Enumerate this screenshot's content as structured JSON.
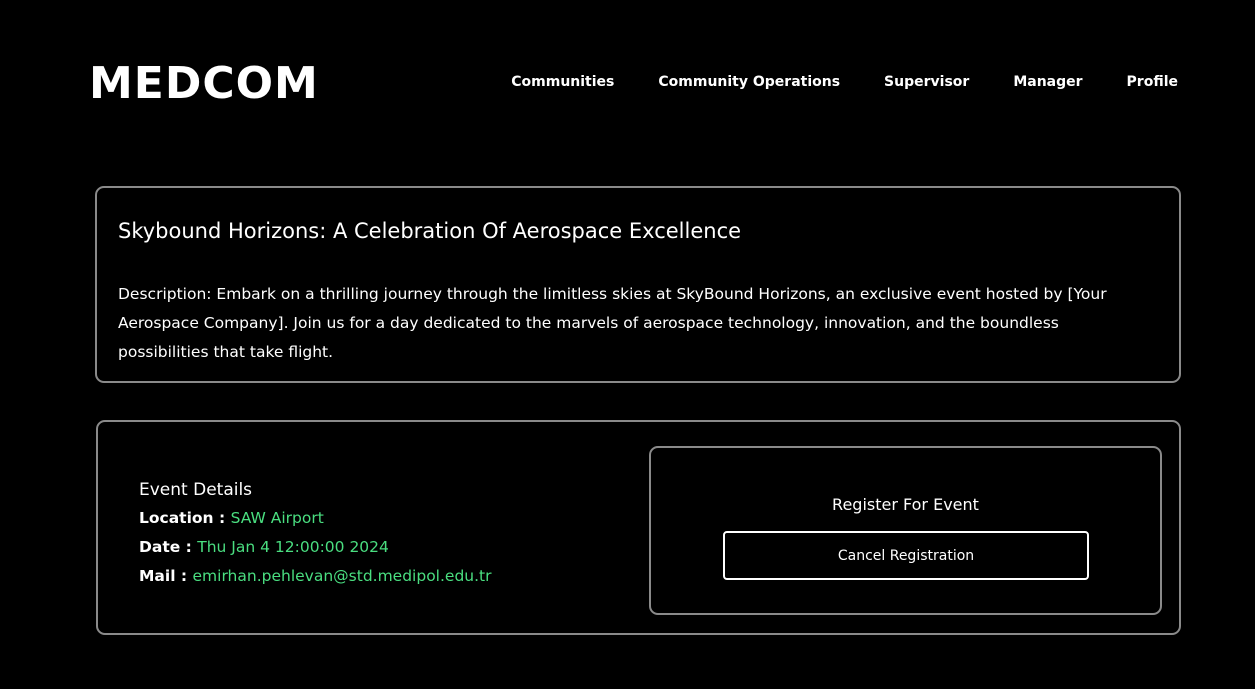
{
  "brand": {
    "logo_text": "MEDCOM"
  },
  "nav": {
    "items": [
      {
        "label": "Communities"
      },
      {
        "label": "Community Operations"
      },
      {
        "label": "Supervisor"
      },
      {
        "label": "Manager"
      },
      {
        "label": "Profile"
      }
    ]
  },
  "event": {
    "title": "Skybound Horizons: A Celebration Of Aerospace Excellence",
    "description": "Description: Embark on a thrilling journey through the limitless skies at SkyBound Horizons, an exclusive event hosted by [Your Aerospace Company]. Join us for a day dedicated to the marvels of aerospace technology, innovation, and the boundless possibilities that take flight."
  },
  "details": {
    "heading": "Event Details",
    "location_label": "Location : ",
    "location_value": "SAW Airport",
    "date_label": "Date : ",
    "date_value": "Thu Jan 4 12:00:00 2024",
    "mail_label": "Mail : ",
    "mail_value": "emirhan.pehlevan@std.medipol.edu.tr"
  },
  "registration": {
    "title": "Register For Event",
    "button_label": "Cancel Registration"
  },
  "colors": {
    "background": "#000000",
    "text": "#ffffff",
    "accent_value": "#4ade80",
    "border": "#8a8a8a"
  }
}
